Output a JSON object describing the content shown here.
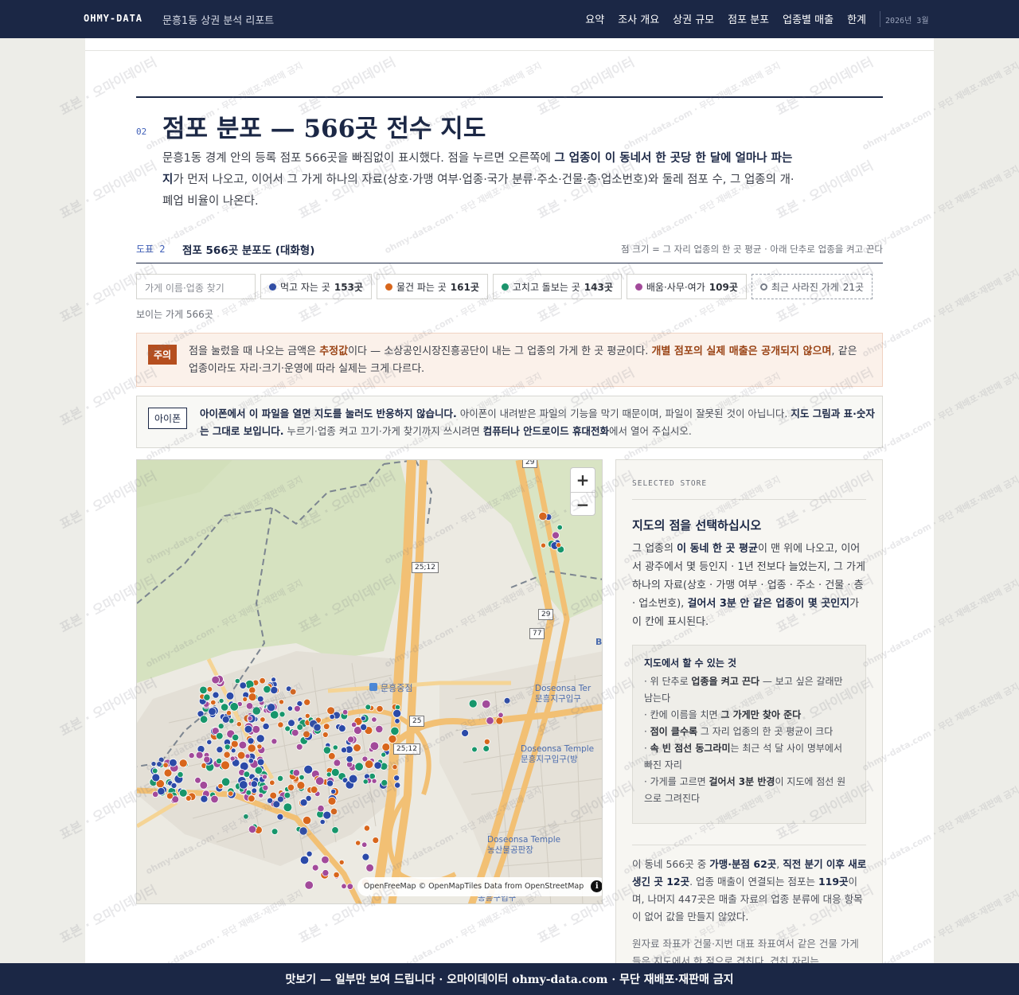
{
  "header": {
    "brand": "OHMY-DATA",
    "report_title": "문흥1동 상권 분석 리포트",
    "nav": [
      "요약",
      "조사 개요",
      "상권 규모",
      "점포 분포",
      "업종별 매출",
      "한계"
    ],
    "date": "2026년 3월"
  },
  "section": {
    "number": "02",
    "title": "점포 분포 — 566곳 전수 지도",
    "intro_1": "문흥1동 경계 안의 등록 점포 566곳을 빠짐없이 표시했다. 점을 누르면 오른쪽에 ",
    "intro_bold": "그 업종이 이 동네서 한 곳당 한 달에 얼마나 파는지",
    "intro_2": "가 먼저 나오고, 이어서 그 가게 하나의 자료(상호·가맹 여부·업종·국가 분류·주소·건물·층·업소번호)와 둘레 점포 수, 그 업종의 개·폐업 비율이 나온다."
  },
  "figure": {
    "label": "도표 2",
    "title": "점포 566곳 분포도 (대화형)",
    "note": "점 크기 = 그 자리 업종의 한 곳 평균 · 아래 단추로 업종을 켜고 끈다"
  },
  "controls": {
    "search_placeholder": "가게 이름·업종 찾기",
    "filters": [
      {
        "label": "먹고 자는 곳",
        "count": "153곳",
        "color": "#2b4aa8"
      },
      {
        "label": "물건 파는 곳",
        "count": "161곳",
        "color": "#d8661c"
      },
      {
        "label": "고치고 돌보는 곳",
        "count": "143곳",
        "color": "#17966b"
      },
      {
        "label": "배움·사무·여가",
        "count": "109곳",
        "color": "#a24a9a"
      }
    ],
    "closed_filter": {
      "label": "최근 사라진 가게",
      "count": "21곳"
    },
    "visible_count": "보이는 가게 566곳"
  },
  "caution": {
    "tag": "주의",
    "t1": "점을 눌렀을 때 나오는 금액은 ",
    "b1": "추정값",
    "t2": "이다 — 소상공인시장진흥공단이 내는 그 업종의 가게 한 곳 평균이다. ",
    "b2": "개별 점포의 실제 매출은 공개되지 않으며",
    "t3": ", 같은 업종이라도 자리·크기·운영에 따라 실제는 크게 다르다."
  },
  "iphone_notice": {
    "tag": "아이폰",
    "b1": "아이폰에서 이 파일을 열면 지도를 눌러도 반응하지 않습니다.",
    "t1": " 아이폰이 내려받은 파일의 기능을 막기 때문이며, 파일이 잘못된 것이 아닙니다. ",
    "b2": "지도 그림과 표·숫자는 그대로 보입니다.",
    "t2": " 누르기·업종 켜고 끄기·가게 찾기까지 쓰시려면 ",
    "b3": "컴퓨터나 안드로이드 휴대전화",
    "t3": "에서 열어 주십시오."
  },
  "map": {
    "zoom_in": "+",
    "zoom_out": "−",
    "attribution": "OpenFreeMap © OpenMapTiles Data from OpenStreetMap",
    "info": "i",
    "labels": {
      "station1": "문흥중점",
      "stop1a": "Doseonsa Ter",
      "stop1b": "문흥지구입구",
      "stop2a": "Doseonsa Temple",
      "stop2b": "문흥지구입구(방",
      "stop3a": "Doseonsa Temple",
      "stop3b": "농산물공판장",
      "bottom": "농흥구입구",
      "r25_12a": "25;12",
      "r25_12b": "25;12",
      "r25": "25",
      "r29": "29",
      "r77": "77",
      "r29top": "29",
      "edge_b1": "B",
      "edge_b2": "B"
    }
  },
  "panel": {
    "kicker": "SELECTED STORE",
    "heading": "지도의 점을 선택하십시오",
    "d1": "그 업종의 ",
    "d1b": "이 동네 한 곳 평균",
    "d2": "이 맨 위에 나오고, 이어서 광주에서 몇 등인지 · 1년 전보다 늘었는지, 그 가게 하나의 자료(상호 · 가맹 여부 · 업종 · 주소 · 건물 · 층 · 업소번호), ",
    "d2b": "걸어서 3분 안 같은 업종이 몇 곳인지",
    "d3": "가 이 칸에 표시된다.",
    "howto_title": "지도에서 할 수 있는 것",
    "howto": [
      {
        "pre": "· 위 단추로 ",
        "bold": "업종을 켜고 끈다",
        "post": " — 보고 싶은 갈래만 남는다"
      },
      {
        "pre": "· 칸에 이름을 치면 ",
        "bold": "그 가게만 찾아 준다",
        "post": ""
      },
      {
        "pre": "· ",
        "bold": "점이 클수록",
        "post": " 그 자리 업종의 한 곳 평균이 크다"
      },
      {
        "pre": "· ",
        "bold": "속 빈 점선 동그라미",
        "post": "는 최근 석 달 사이 명부에서 빠진 자리"
      },
      {
        "pre": "· 가게를 고르면 ",
        "bold": "걸어서 3분 반경",
        "post": "이 지도에 점선 원으로 그려진다"
      }
    ],
    "s1": "이 동네 566곳 중 ",
    "s1b": "가맹·분점 62곳",
    "s2": ", ",
    "s2b": "직전 분기 이후 새로 생긴 곳 12곳",
    "s3": ". 업종 매출이 연결되는 점포는 ",
    "s3b": "119곳",
    "s4": "이며, 나머지 447곳은 매출 자료의 업종 분류에 대응 항목이 없어 값을 만들지 않았다.",
    "coord": "원자료 좌표가 건물·지번 대표 좌표여서 같은 건물 가게들은 지도에서 한 점으로 겹친다. 겹친 자리는"
  },
  "watermark": {
    "text1": "표본 · 오마이데이터",
    "text2": "ohmy-data.com · 무단 재배포·재판매 금지"
  },
  "banner": {
    "text": "맛보기 — 일부만 보여 드립니다 · 오마이데이터 ohmy-data.com · 무단 재배포·재판매 금지"
  }
}
